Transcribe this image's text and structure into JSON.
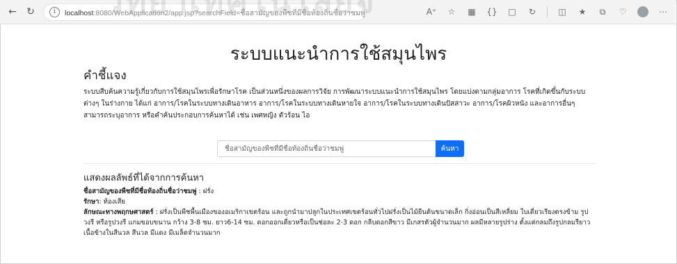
{
  "browser": {
    "url_host": "localhost",
    "url_rest": ":8080/WebApplication2/app.jsp?searchField=ชื่อสามัญของพืชที่มีชื่อท้องถิ่นชื่อว่าชมพู่"
  },
  "watermark": "วิทยาเทคโนโลยีจ",
  "page": {
    "title": "ระบบแนะนำการใช้สมุนไพร",
    "instructions_heading": "คำชี้แจง",
    "instructions_text": "ระบบสืบค้นความรู้เกี่ยวกับการใช้สมุนไพรเพื่อรักษาโรค เป็นส่วนหนึ่งของผลการวิจัย การพัฒนาระบบแนะนำการใช้สมุนไพร โดยแบ่งตามกลุ่มอาการ โรคที่เกิดขึ้นกับระบบต่างๆ ในร่างกาย ได้แก่ อาการ/โรคในระบบทางเดินอาหาร อาการ/โรคในระบบทางเดินหายใจ อาการ/โรคในระบบทางเดินปัสสาวะ อาการ/โรคผิวหนัง และอาการอื่นๆ สามารถระบุอาการ หรือคำค้นประกอบการค้นหาได้ เช่น เพศหญิง ตัวร้อน ไอ"
  },
  "search": {
    "value": "ชื่อสามัญของพืชที่มีชื่อท้องถิ่นชื่อว่าชมพู่",
    "button_label": "ค้นหา"
  },
  "results": {
    "heading": "แสดงผลลัพธ์ที่ได้จากการค้นหา",
    "q_label": "ชื่อสามัญของพืชที่มีชื่อท้องถิ่นชื่อว่าชมพู่",
    "q_value": " : ฝรั่ง",
    "treat_label": "รักษา",
    "treat_value": ": ท้องเสีย",
    "botany_label": "ลักษณะทางพฤกษศาสตร์",
    "botany_value": " : ฝรั่งเป็นพืชพื้นเมืองของอเมริกาเขตร้อน และถูกนำมาปลูกในประเทศเขตร้อนทั่วไปฝรั่งเป็นไม้ยืนต้นขนาดเล็ก กิ่งอ่อนเป็นสีเหลี่ยม ใบเดี่ยวเรียงตรงข้าม รูปวงรี หรือรูปวงรี แกมขอบขนาน กว้าง 3-8 ซม. ยาว6-14 ซม. ดอกออกเดี่ยวหรือเป็นช่อละ 2-3 ดอก กลีบดอกสีขาว มีเกสรตัวผู้จำนวนมาก ผลมีหลายรูปร่าง ตั้งแต่กลมถึงรูปกลมรียาว เนื้อข้างในสีนวล สีนวล มีแดง มีเมล็ดจำนวนมาก"
  }
}
